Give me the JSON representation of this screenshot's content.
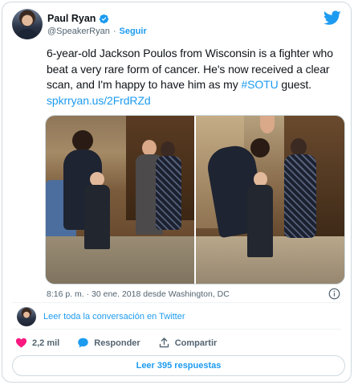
{
  "author": {
    "display_name": "Paul Ryan",
    "handle": "@SpeakerRyan",
    "separator": "·",
    "follow_label": "Seguir",
    "verified_color": "#1d9bf0"
  },
  "tweet": {
    "text_main": "6-year-old Jackson Poulos from Wisconsin is a fighter who beat a very rare form of cancer. He's now received a clear scan, and I'm happy to have him as my ",
    "hashtag": "#SOTU",
    "text_after": " guest. ",
    "url": "spkrryan.us/2FrdRZd",
    "timestamp": "8:16 p. m. · 30 ene. 2018 desde Washington, DC"
  },
  "conversation": {
    "label": "Leer toda la conversación en Twitter"
  },
  "actions": {
    "likes_count": "2,2 mil",
    "reply_label": "Responder",
    "share_label": "Compartir"
  },
  "replies_button": {
    "label": "Leer 395 respuestas"
  },
  "colors": {
    "accent": "#1d9bf0",
    "like": "#f91880",
    "text": "#0f1419",
    "secondary": "#536471",
    "border": "#cfd9de"
  },
  "icons": [
    "verified-badge-icon",
    "twitter-bird-icon",
    "info-icon",
    "heart-icon",
    "reply-bubble-icon",
    "share-icon"
  ]
}
